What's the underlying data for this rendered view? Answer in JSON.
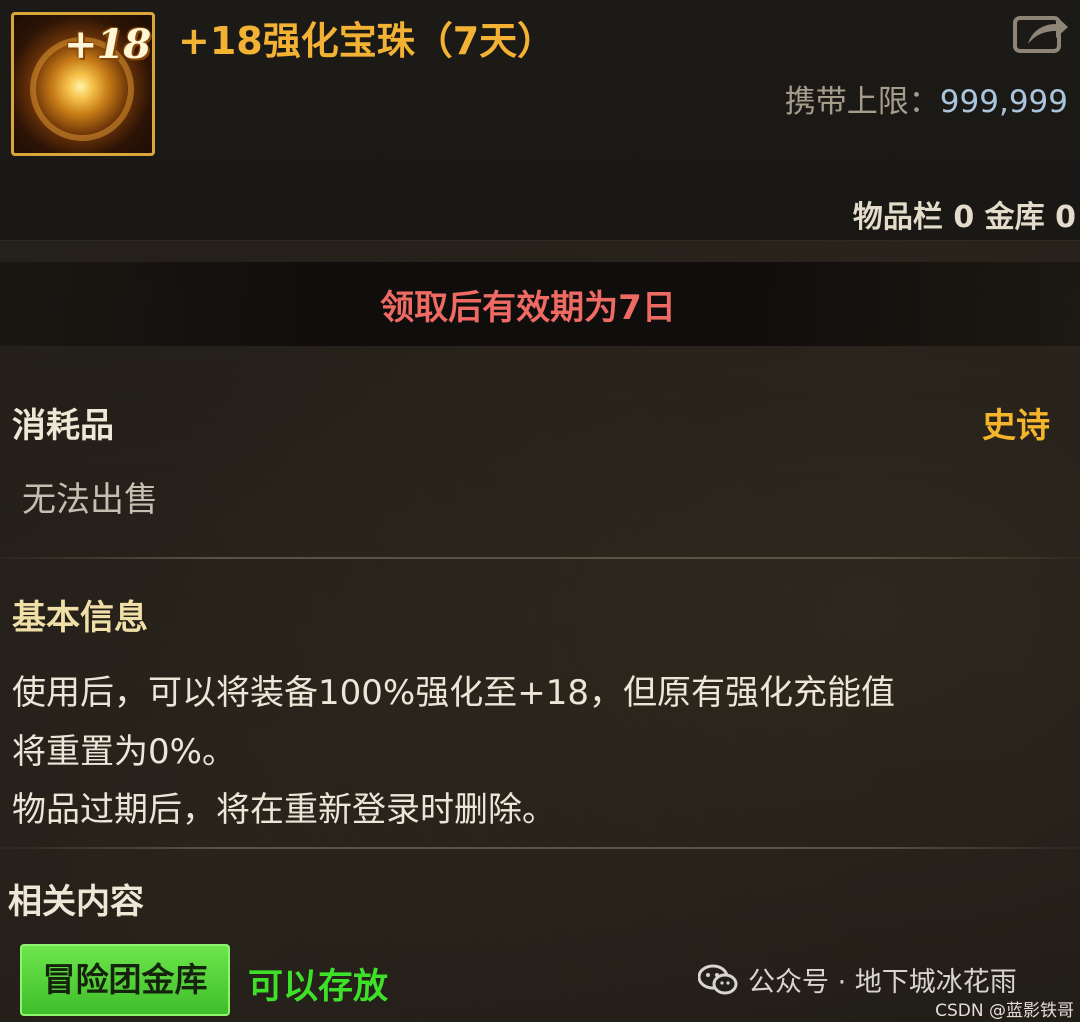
{
  "item": {
    "title": "+18强化宝珠（7天）",
    "icon_badge": "+18",
    "carry_limit_label": "携带上限：",
    "carry_limit_value": "999,999",
    "inventory_label": "物品栏",
    "inventory_count": "0",
    "vault_label": "金库",
    "vault_count": "0"
  },
  "validity": {
    "text": "领取后有效期为7日"
  },
  "meta": {
    "category": "消耗品",
    "rarity": "史诗",
    "sell_status": "无法出售"
  },
  "basic_info": {
    "heading": "基本信息",
    "lines": [
      "使用后，可以将装备100%强化至+18，但原有强化充能值",
      "将重置为0%。",
      "物品过期后，将在重新登录时删除。"
    ]
  },
  "related": {
    "heading": "相关内容",
    "button_label": "冒险团金库",
    "status_text": "可以存放"
  },
  "watermark": {
    "text": "公众号 · 地下城冰花雨",
    "csdn": "CSDN @蓝影铁哥"
  },
  "colors": {
    "title": "#f3b233",
    "rarity_epic": "#f4b52a",
    "validity": "#f06a64",
    "storable": "#3fe02a",
    "button_bg": "#4fd03a"
  },
  "icons": {
    "item": "enhancement-orb-icon",
    "share": "share-icon",
    "watermark": "wechat-icon"
  }
}
